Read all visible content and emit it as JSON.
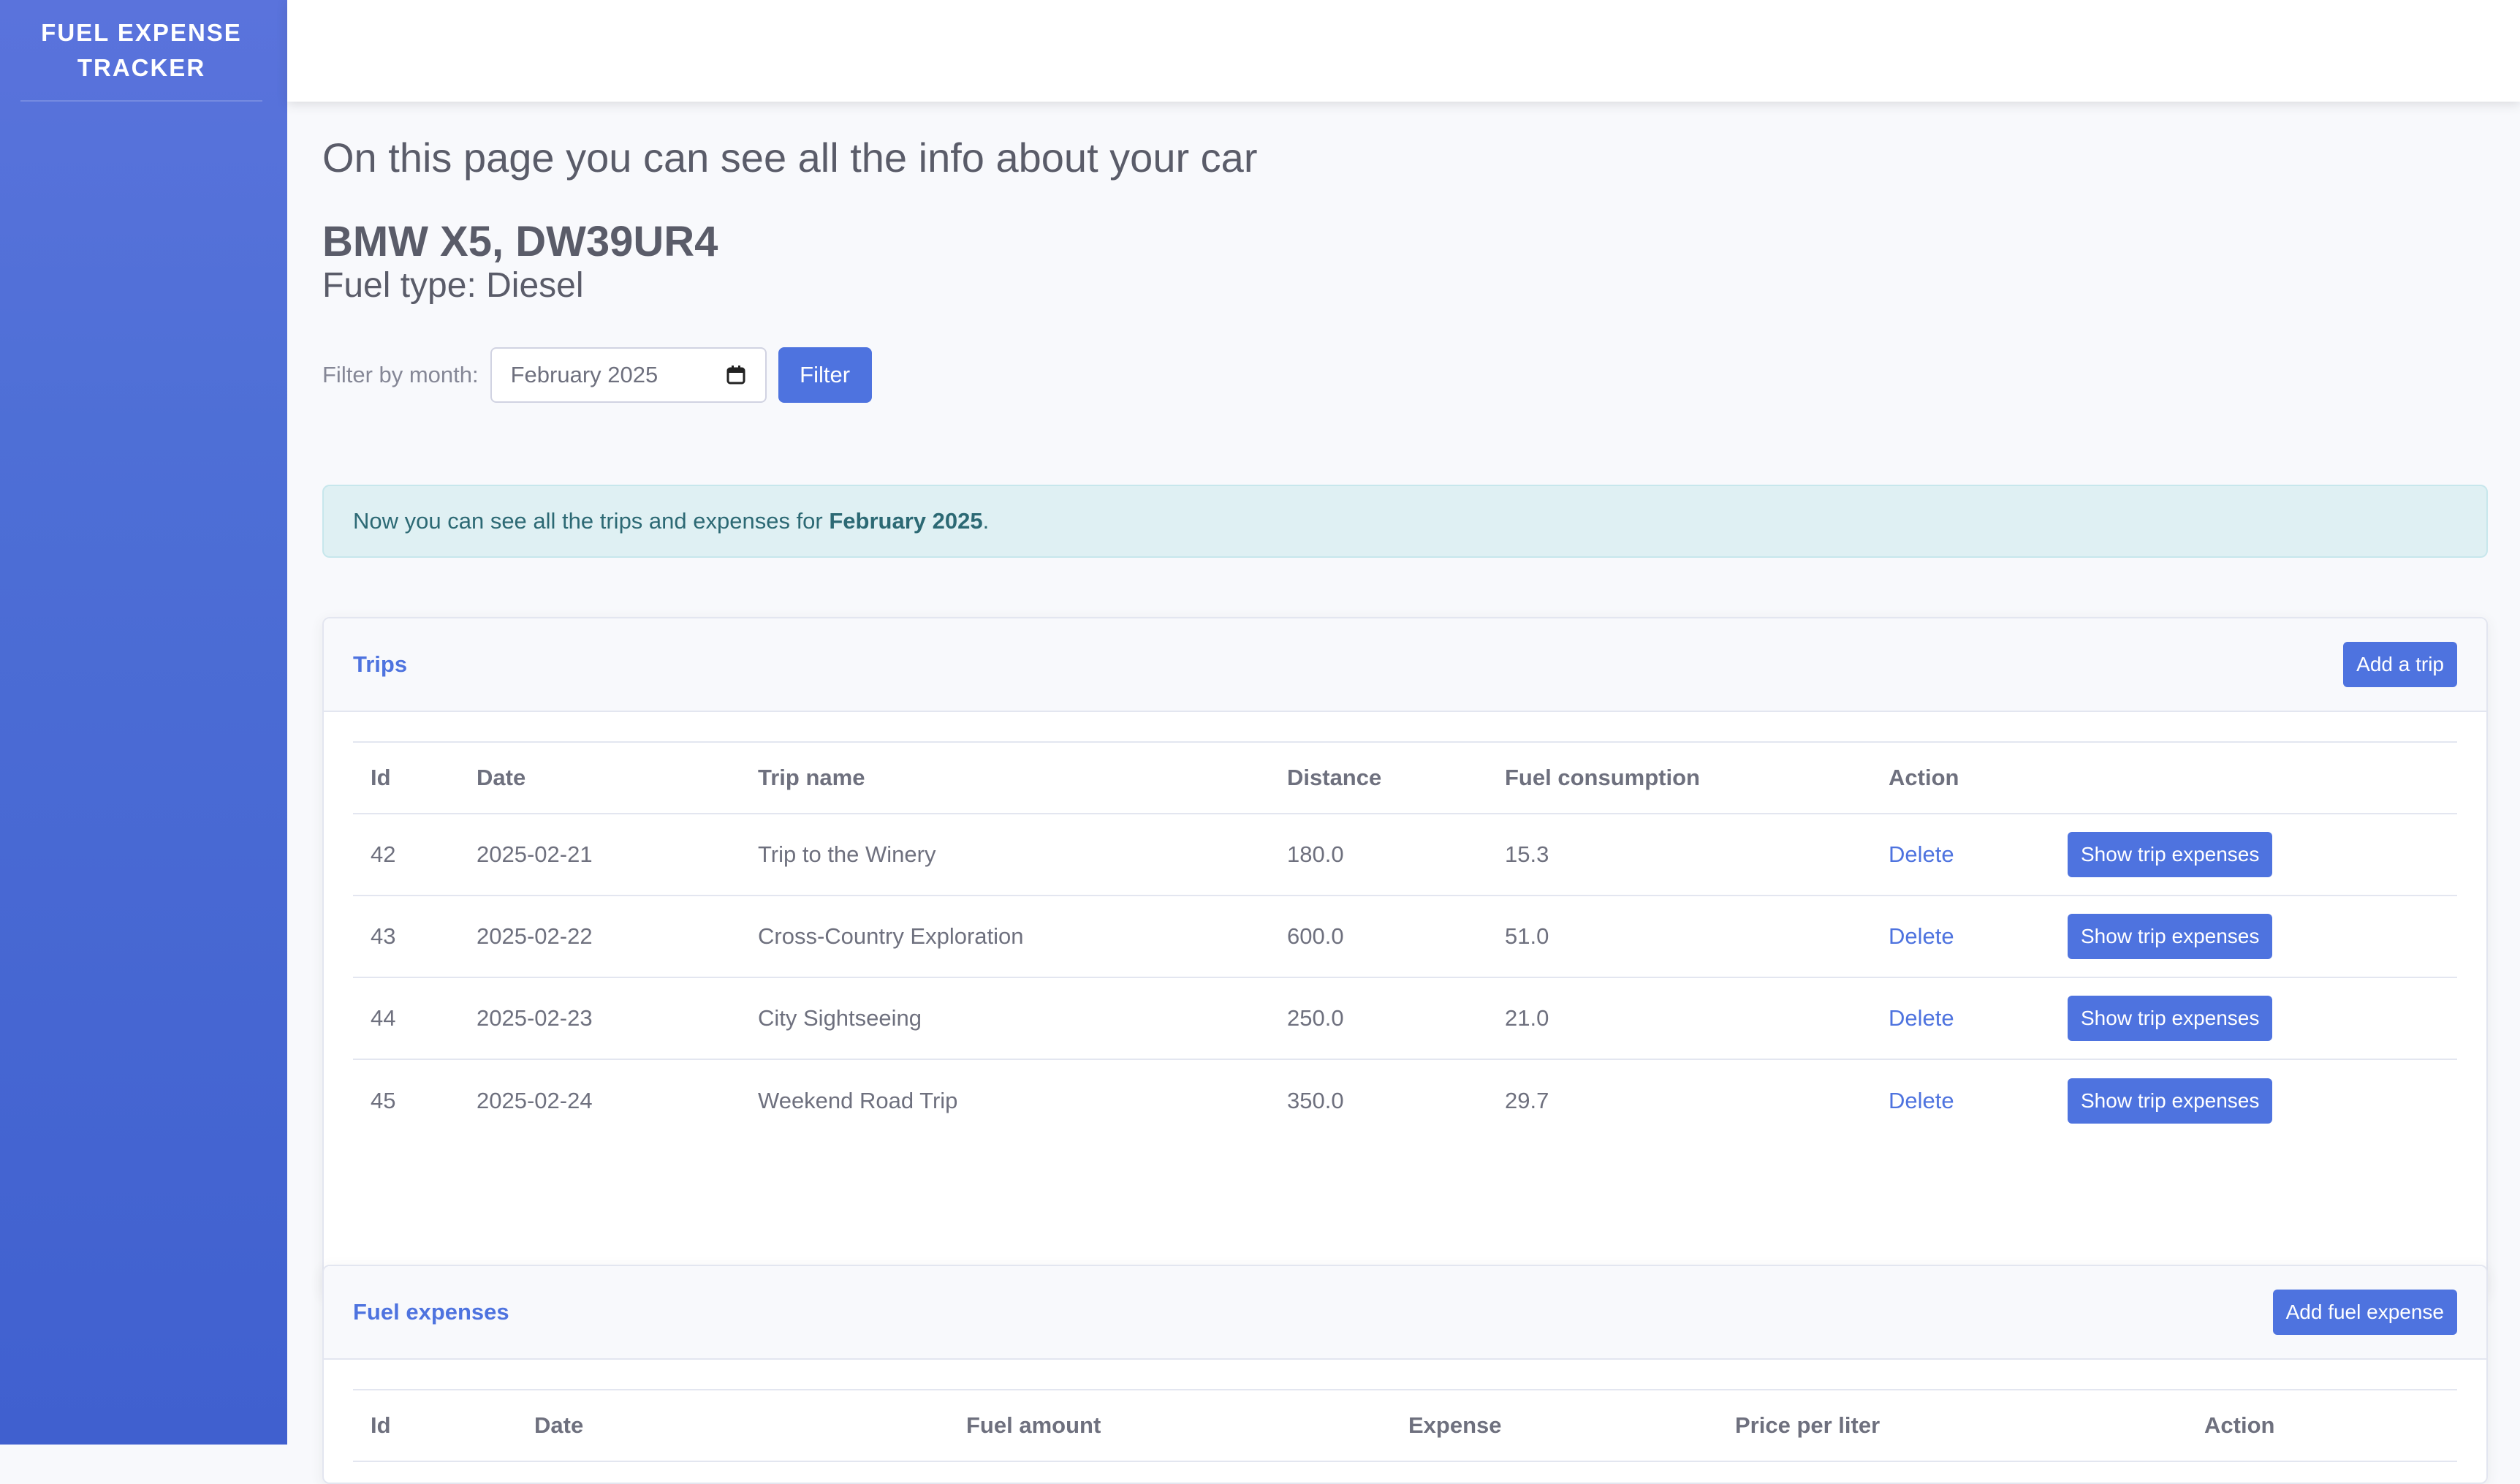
{
  "sidebar": {
    "brand_line1": "FUEL EXPENSE",
    "brand_line2": "TRACKER"
  },
  "page": {
    "heading": "On this page you can see all the info about your car",
    "car_title": "BMW X5, DW39UR4",
    "fuel_type": "Fuel type: Diesel"
  },
  "filter": {
    "label": "Filter by month:",
    "month_value": "February  2025",
    "button_label": "Filter"
  },
  "alert": {
    "prefix": "Now you can see all the trips and expenses for ",
    "month": "February 2025",
    "suffix": "."
  },
  "trips": {
    "title": "Trips",
    "add_label": "Add a trip",
    "columns": [
      "Id",
      "Date",
      "Trip name",
      "Distance",
      "Fuel consumption",
      "Action"
    ],
    "rows": [
      {
        "id": "42",
        "date": "2025-02-21",
        "name": "Trip to the Winery",
        "distance": "180.0",
        "fuel": "15.3",
        "delete": "Delete",
        "show": "Show trip expenses"
      },
      {
        "id": "43",
        "date": "2025-02-22",
        "name": "Cross-Country Exploration",
        "distance": "600.0",
        "fuel": "51.0",
        "delete": "Delete",
        "show": "Show trip expenses"
      },
      {
        "id": "44",
        "date": "2025-02-23",
        "name": "City Sightseeing",
        "distance": "250.0",
        "fuel": "21.0",
        "delete": "Delete",
        "show": "Show trip expenses"
      },
      {
        "id": "45",
        "date": "2025-02-24",
        "name": "Weekend Road Trip",
        "distance": "350.0",
        "fuel": "29.7",
        "delete": "Delete",
        "show": "Show trip expenses"
      }
    ]
  },
  "fuel_expenses": {
    "title": "Fuel expenses",
    "add_label": "Add fuel expense",
    "columns": [
      "Id",
      "Date",
      "Fuel amount",
      "Expense",
      "Price per liter",
      "Action"
    ]
  },
  "colors": {
    "primary": "#4e73df",
    "sidebar": "#4e6fd6",
    "alert_bg": "#dff0f3"
  },
  "icons": {
    "calendar": "calendar-icon"
  }
}
